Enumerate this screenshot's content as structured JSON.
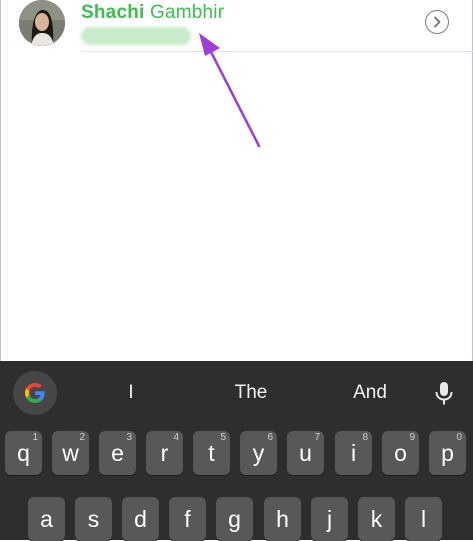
{
  "contact": {
    "first_name": "Shachi",
    "last_name": "Gambhir",
    "name_color": "#3cbf4e"
  },
  "icons": {
    "avatar": "contact-photo",
    "info": "chevron-right-circle-icon",
    "annotation": "purple-arrow",
    "google": "google-g-icon",
    "mic": "microphone-icon"
  },
  "keyboard": {
    "suggestions": [
      "I",
      "The",
      "And"
    ],
    "row1": [
      {
        "key": "q",
        "hint": "1"
      },
      {
        "key": "w",
        "hint": "2"
      },
      {
        "key": "e",
        "hint": "3"
      },
      {
        "key": "r",
        "hint": "4"
      },
      {
        "key": "t",
        "hint": "5"
      },
      {
        "key": "y",
        "hint": "6"
      },
      {
        "key": "u",
        "hint": "7"
      },
      {
        "key": "i",
        "hint": "8"
      },
      {
        "key": "o",
        "hint": "9"
      },
      {
        "key": "p",
        "hint": "0"
      }
    ],
    "row2": [
      "a",
      "s",
      "d",
      "f",
      "g",
      "h",
      "j",
      "k",
      "l"
    ]
  },
  "colors": {
    "keyboard_bg": "#2e2e2e",
    "key_bg": "#585858",
    "annotation_arrow": "#9b3fd6"
  }
}
